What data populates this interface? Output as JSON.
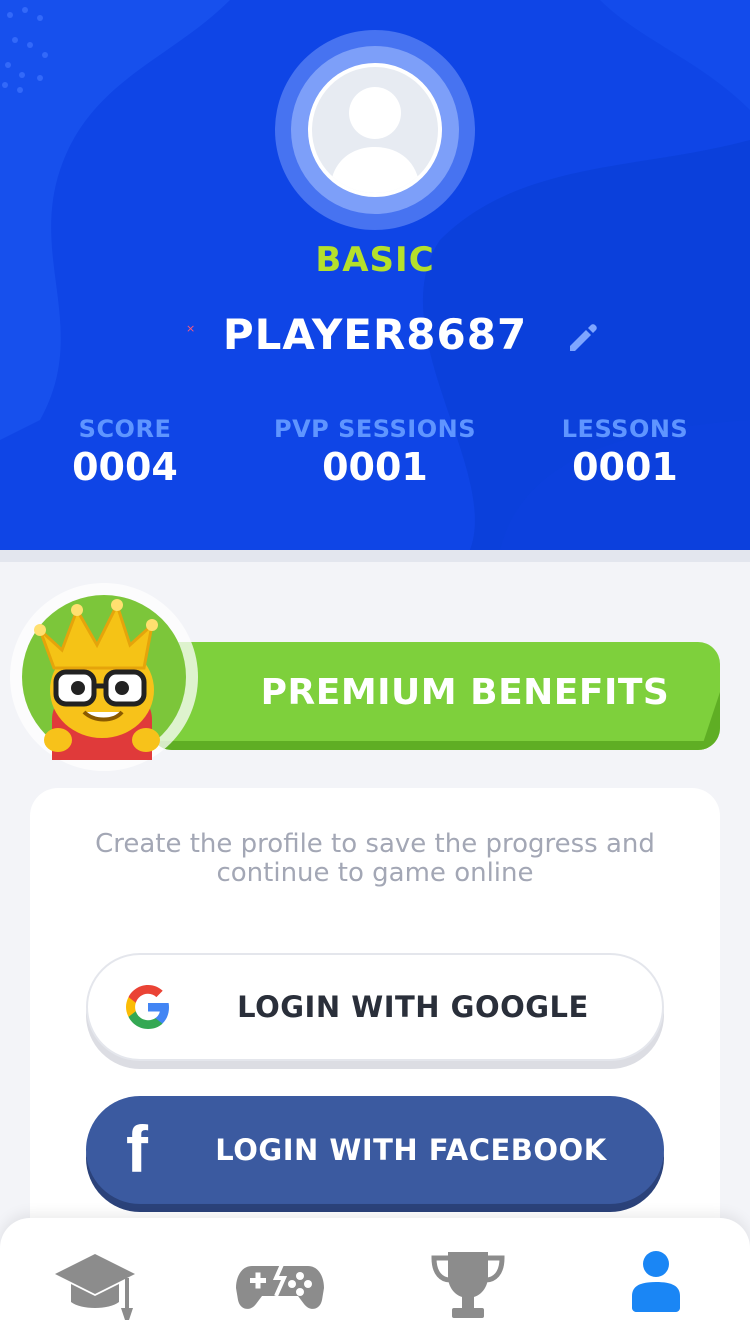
{
  "profile": {
    "tier": "BASIC",
    "player_name": "PLAYER8687",
    "tier_color": "#b5e02b"
  },
  "stats": [
    {
      "label": "SCORE",
      "value": "0004"
    },
    {
      "label": "PVP SESSIONS",
      "value": "0001"
    },
    {
      "label": "LESSONS",
      "value": "0001"
    }
  ],
  "premium": {
    "label": "PREMIUM BENEFITS",
    "color": "#7ed03c"
  },
  "login_card": {
    "message": "Create the profile to save the progress and continue to game online",
    "google_label": "LOGIN WITH GOOGLE",
    "facebook_label": "LOGIN WITH FACEBOOK",
    "facebook_color": "#3b5aa0"
  },
  "nav": {
    "items": [
      {
        "icon": "graduation-cap-icon",
        "active": false
      },
      {
        "icon": "gamepad-icon",
        "active": false
      },
      {
        "icon": "trophy-icon",
        "active": false
      },
      {
        "icon": "user-icon",
        "active": true
      }
    ],
    "active_color": "#1a86f5",
    "inactive_color": "#8c8c8c"
  },
  "colors": {
    "header_bg": "#0f45e6",
    "page_bg": "#f3f4f8"
  }
}
